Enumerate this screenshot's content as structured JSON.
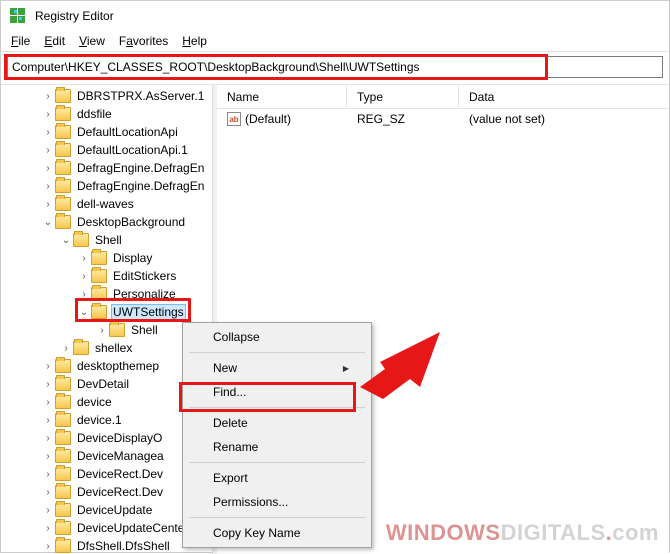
{
  "window": {
    "title": "Registry Editor"
  },
  "menu": {
    "file": "File",
    "edit": "Edit",
    "view": "View",
    "favorites": "Favorites",
    "help": "Help"
  },
  "address": {
    "path": "Computer\\HKEY_CLASSES_ROOT\\DesktopBackground\\Shell\\UWTSettings"
  },
  "columns": {
    "name": "Name",
    "type": "Type",
    "data": "Data"
  },
  "values": [
    {
      "name": "(Default)",
      "type": "REG_SZ",
      "data": "(value not set)"
    }
  ],
  "tree": [
    {
      "label": "DBRSTPRX.AsServer.1",
      "indent": 1,
      "twisty": ">"
    },
    {
      "label": "ddsfile",
      "indent": 1,
      "twisty": ">"
    },
    {
      "label": "DefaultLocationApi",
      "indent": 1,
      "twisty": ">"
    },
    {
      "label": "DefaultLocationApi.1",
      "indent": 1,
      "twisty": ">"
    },
    {
      "label": "DefragEngine.DefragEn",
      "indent": 1,
      "twisty": ">"
    },
    {
      "label": "DefragEngine.DefragEn",
      "indent": 1,
      "twisty": ">"
    },
    {
      "label": "dell-waves",
      "indent": 1,
      "twisty": ">"
    },
    {
      "label": "DesktopBackground",
      "indent": 1,
      "twisty": "v"
    },
    {
      "label": "Shell",
      "indent": 2,
      "twisty": "v"
    },
    {
      "label": "Display",
      "indent": 3,
      "twisty": ">"
    },
    {
      "label": "EditStickers",
      "indent": 3,
      "twisty": ">"
    },
    {
      "label": "Personalize",
      "indent": 3,
      "twisty": ">"
    },
    {
      "label": "UWTSettings",
      "indent": 3,
      "twisty": "v",
      "selected": true
    },
    {
      "label": "Shell",
      "indent": 4,
      "twisty": ">"
    },
    {
      "label": "shellex",
      "indent": 2,
      "twisty": ">"
    },
    {
      "label": "desktopthemep",
      "indent": 1,
      "twisty": ">"
    },
    {
      "label": "DevDetail",
      "indent": 1,
      "twisty": ">"
    },
    {
      "label": "device",
      "indent": 1,
      "twisty": ">"
    },
    {
      "label": "device.1",
      "indent": 1,
      "twisty": ">"
    },
    {
      "label": "DeviceDisplayO",
      "indent": 1,
      "twisty": ">"
    },
    {
      "label": "DeviceManagea",
      "indent": 1,
      "twisty": ">"
    },
    {
      "label": "DeviceRect.Dev",
      "indent": 1,
      "twisty": ">"
    },
    {
      "label": "DeviceRect.Dev",
      "indent": 1,
      "twisty": ">"
    },
    {
      "label": "DeviceUpdate",
      "indent": 1,
      "twisty": ">"
    },
    {
      "label": "DeviceUpdateCenter",
      "indent": 1,
      "twisty": ">"
    },
    {
      "label": "DfsShell.DfsShell",
      "indent": 1,
      "twisty": ">"
    }
  ],
  "context": {
    "collapse": "Collapse",
    "new": "New",
    "find": "Find...",
    "delete": "Delete",
    "rename": "Rename",
    "export": "Export",
    "permissions": "Permissions...",
    "copykey": "Copy Key Name"
  },
  "watermark": {
    "part1": "WINDOWS",
    "part2": "DIGITALS"
  }
}
